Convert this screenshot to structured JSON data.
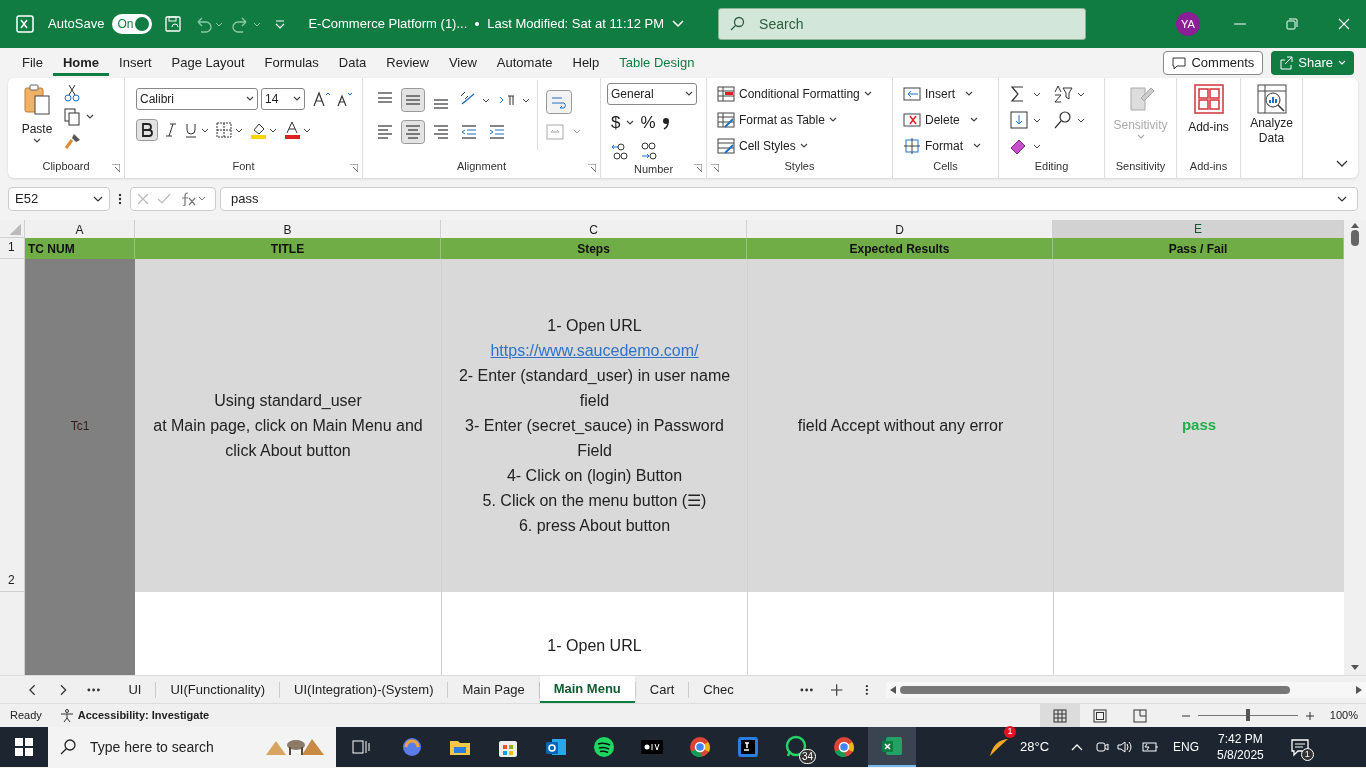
{
  "title_bar": {
    "autosave_label": "AutoSave",
    "autosave": {
      "label": "On",
      "on": true
    },
    "document_title": "E-Commerce Platform (1)...",
    "last_modified": "Last Modified: Sat at 11:12 PM",
    "search_placeholder": "Search",
    "avatar": "YA"
  },
  "menu_tabs": [
    {
      "label": "File",
      "selected": false
    },
    {
      "label": "Home",
      "selected": true
    },
    {
      "label": "Insert",
      "selected": false
    },
    {
      "label": "Page Layout",
      "selected": false
    },
    {
      "label": "Formulas",
      "selected": false
    },
    {
      "label": "Data",
      "selected": false
    },
    {
      "label": "Review",
      "selected": false
    },
    {
      "label": "View",
      "selected": false
    },
    {
      "label": "Automate",
      "selected": false
    },
    {
      "label": "Help",
      "selected": false
    },
    {
      "label": "Table Design",
      "selected": false,
      "kind": "contextual"
    }
  ],
  "comments_button": "Comments",
  "share_button": "Share",
  "ribbon": {
    "clipboard": {
      "paste": "Paste",
      "label": "Clipboard"
    },
    "font": {
      "font_name": "Calibri",
      "font_size": "14",
      "bold": true,
      "label": "Font"
    },
    "alignment": {
      "middle_align": true,
      "center_align": true,
      "label": "Alignment"
    },
    "number": {
      "format": "General",
      "currency": "$",
      "percent": "%",
      "label": "Number"
    },
    "styles": {
      "items": [
        "Conditional Formatting",
        "Format as Table",
        "Cell Styles"
      ],
      "label": "Styles"
    },
    "cells": {
      "items": [
        "Insert",
        "Delete",
        "Format"
      ],
      "label": "Cells"
    },
    "editing": {
      "label": "Editing"
    },
    "sensitivity": {
      "button": "Sensitivity",
      "disabled": true,
      "label": "Sensitivity"
    },
    "addins": {
      "button": "Add-ins",
      "label": "Add-ins"
    },
    "analyze": {
      "button": "Analyze Data"
    }
  },
  "formula_bar": {
    "name_box": "E52",
    "value": "pass"
  },
  "columns": [
    {
      "letter": "A",
      "selected": false
    },
    {
      "letter": "B",
      "selected": false
    },
    {
      "letter": "C",
      "selected": false
    },
    {
      "letter": "D",
      "selected": false
    },
    {
      "letter": "E",
      "selected": true
    }
  ],
  "header_row": {
    "number": "1",
    "cells": [
      "TC NUM",
      "TITLE",
      "Steps",
      "Expected Results",
      "Pass / Fail"
    ]
  },
  "rows": [
    {
      "number": "2",
      "tc": "Tc1",
      "title": [
        "Using standard_user",
        "at Main page, click on Main Menu and click About button"
      ],
      "steps": [
        {
          "kind": "text",
          "text": "1- Open URL"
        },
        {
          "kind": "link",
          "text": "https://www.saucedemo.com/"
        },
        {
          "kind": "text",
          "text": "2- Enter (standard_user) in user name field"
        },
        {
          "kind": "text",
          "text": "3- Enter (secret_sauce) in Password Field"
        },
        {
          "kind": "text",
          "text": "4- Click on (login) Button"
        },
        {
          "kind": "text",
          "text": "5. Click on the menu button (☰)"
        },
        {
          "kind": "text",
          "text": "6. press About button"
        }
      ],
      "expected": "field Accept without any error",
      "result": "pass"
    },
    {
      "tc": "",
      "title": [],
      "steps": [
        {
          "kind": "text",
          "text": "1- Open URL"
        }
      ],
      "expected": "",
      "result": ""
    }
  ],
  "sheet_tabs": [
    {
      "label": "UI",
      "selected": false
    },
    {
      "label": "UI(Functionality)",
      "selected": false
    },
    {
      "label": "UI(Integration)-(System)",
      "selected": false
    },
    {
      "label": "Main Page",
      "selected": false
    },
    {
      "label": "Main Menu",
      "selected": true
    },
    {
      "label": "Cart",
      "selected": false
    },
    {
      "label": "Chec",
      "selected": false
    }
  ],
  "status_bar": {
    "ready": "Ready",
    "accessibility": "Accessibility: Investigate",
    "views": [
      {
        "selected": true
      },
      {
        "selected": false
      },
      {
        "selected": false
      }
    ],
    "zoom": "100%",
    "level": 0.5
  },
  "taskbar": {
    "search_placeholder": "Type here to search",
    "whatsapp_badge": "34",
    "weather_badge": "1",
    "temperature": "28°C",
    "language": "ENG",
    "time": "7:42 PM",
    "date": "5/8/2025",
    "notifications": "1"
  }
}
